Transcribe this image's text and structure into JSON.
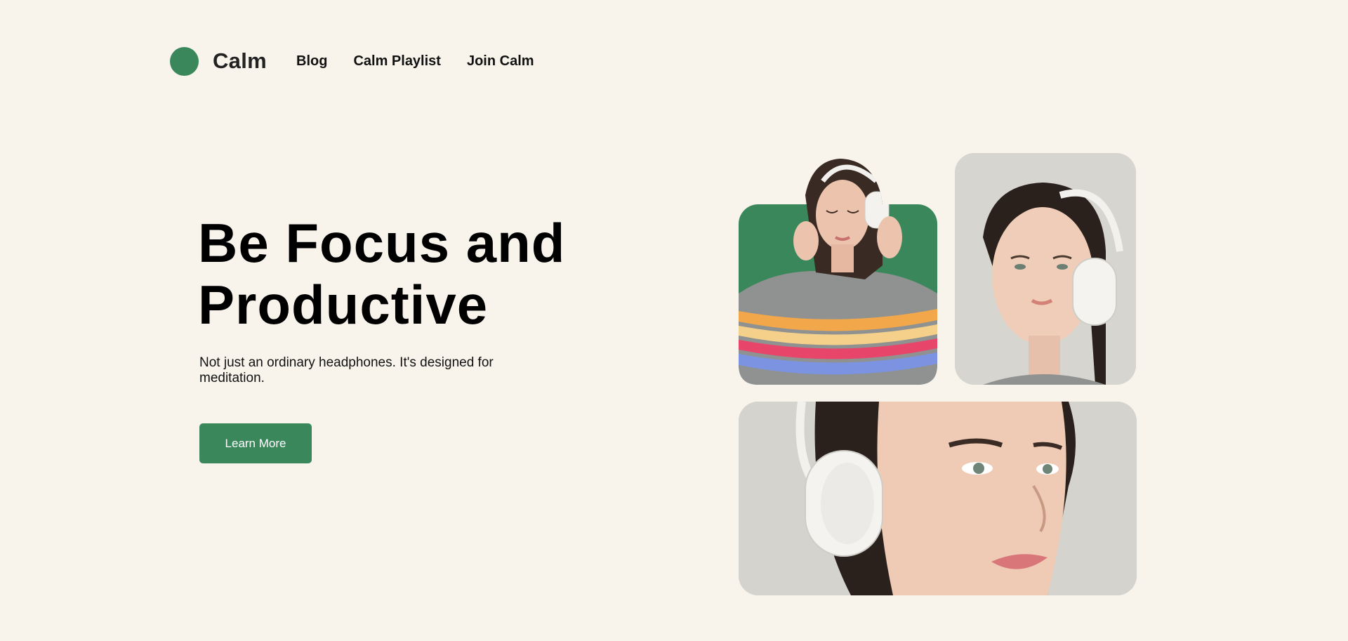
{
  "header": {
    "brand": "Calm",
    "nav": [
      "Blog",
      "Calm Playlist",
      "Join Calm"
    ]
  },
  "hero": {
    "title_line1": "Be Focus and",
    "title_line2": "Productive",
    "subtitle": "Not just an ordinary headphones. It's designed for meditation.",
    "cta_label": "Learn More"
  },
  "colors": {
    "background": "#f8f4ec",
    "accent": "#3a875c",
    "text": "#000000"
  },
  "images": [
    {
      "name": "woman-sweater-headphones-photo"
    },
    {
      "name": "woman-portrait-headphones-photo"
    },
    {
      "name": "woman-closeup-headphones-photo"
    }
  ]
}
